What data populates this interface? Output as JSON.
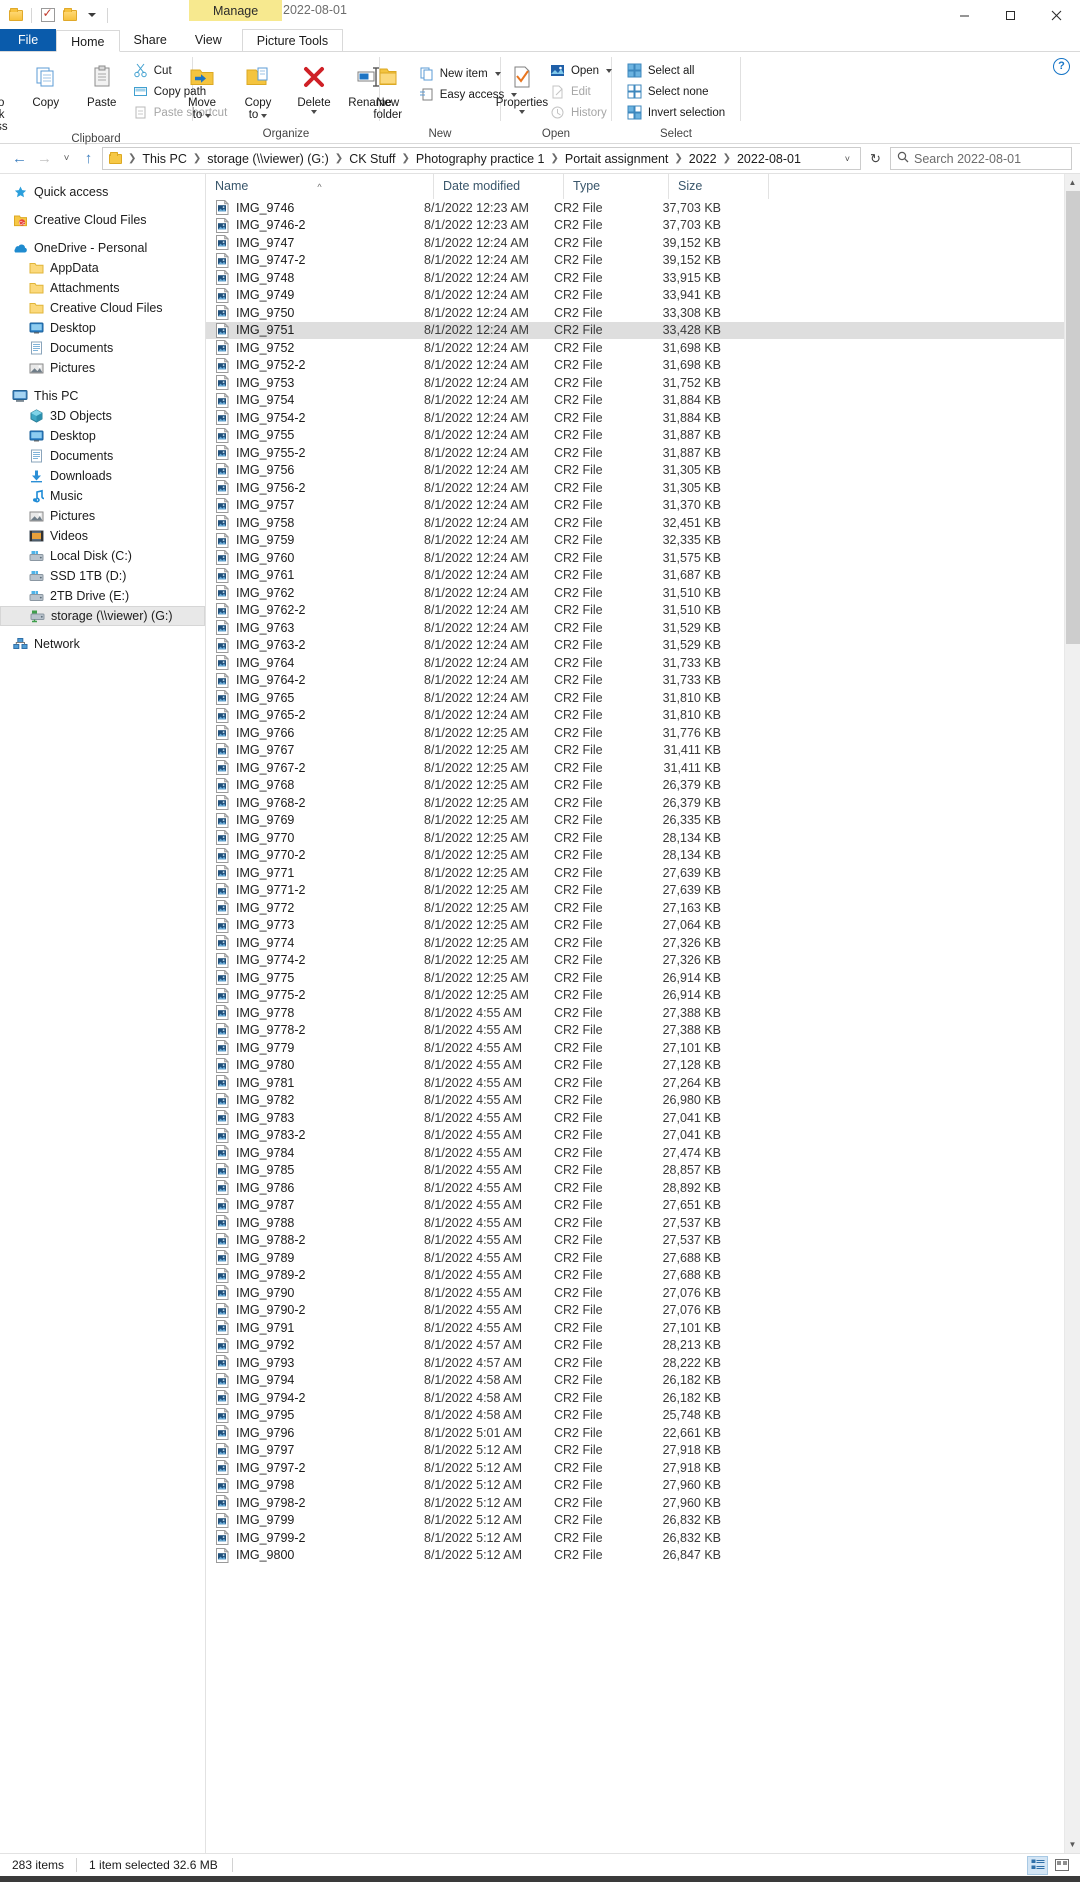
{
  "window": {
    "contextual_tab": "Manage",
    "title": "2022-08-01",
    "minimize": "minimize",
    "maximize": "maximize",
    "close": "close",
    "help": "?"
  },
  "quick_access_toolbar": {
    "items": [
      "folder-icon",
      "properties-icon",
      "new-folder-icon",
      "customize-caret"
    ]
  },
  "ribbon_tabs": [
    {
      "label": "File",
      "id": "file"
    },
    {
      "label": "Home",
      "id": "home"
    },
    {
      "label": "Share",
      "id": "share"
    },
    {
      "label": "View",
      "id": "view"
    },
    {
      "label": "Picture Tools",
      "id": "picture-tools"
    }
  ],
  "ribbon": {
    "groups": [
      {
        "label": "Clipboard",
        "big": [
          {
            "label": "Pin to Quick\naccess",
            "line1": "Pin to Quick",
            "line2": "access",
            "icon": "pin-icon"
          },
          {
            "label": "Copy",
            "line1": "Copy",
            "line2": "",
            "icon": "copy-icon"
          },
          {
            "label": "Paste",
            "line1": "Paste",
            "line2": "",
            "icon": "paste-icon"
          }
        ],
        "small": [
          {
            "label": "Cut",
            "icon": "scissors-icon",
            "disabled": false
          },
          {
            "label": "Copy path",
            "icon": "copy-path-icon",
            "disabled": false
          },
          {
            "label": "Paste shortcut",
            "icon": "paste-shortcut-icon",
            "disabled": true
          }
        ]
      },
      {
        "label": "Organize",
        "big": [
          {
            "line1": "Move",
            "line2": "to",
            "icon": "move-to-icon",
            "caret": true
          },
          {
            "line1": "Copy",
            "line2": "to",
            "icon": "copy-to-icon",
            "caret": true
          },
          {
            "line1": "Delete",
            "line2": "",
            "icon": "delete-icon",
            "caret": true
          },
          {
            "line1": "Rename",
            "line2": "",
            "icon": "rename-icon",
            "caret": false
          }
        ],
        "small": []
      },
      {
        "label": "New",
        "big": [
          {
            "line1": "New",
            "line2": "folder",
            "icon": "new-folder-icon",
            "caret": false
          }
        ],
        "small": [
          {
            "label": "New item",
            "icon": "new-item-icon",
            "disabled": false,
            "caret": true
          },
          {
            "label": "Easy access",
            "icon": "easy-access-icon",
            "disabled": false,
            "caret": true
          }
        ]
      },
      {
        "label": "Open",
        "big": [
          {
            "line1": "Properties",
            "line2": "",
            "icon": "properties-icon",
            "caret": true
          }
        ],
        "small": [
          {
            "label": "Open",
            "icon": "open-icon",
            "disabled": false,
            "caret": true
          },
          {
            "label": "Edit",
            "icon": "edit-icon",
            "disabled": true,
            "caret": false
          },
          {
            "label": "History",
            "icon": "history-icon",
            "disabled": true,
            "caret": false
          }
        ]
      },
      {
        "label": "Select",
        "big": [],
        "small": [
          {
            "label": "Select all",
            "icon": "select-all-icon",
            "disabled": false
          },
          {
            "label": "Select none",
            "icon": "select-none-icon",
            "disabled": false
          },
          {
            "label": "Invert selection",
            "icon": "invert-selection-icon",
            "disabled": false
          }
        ]
      }
    ]
  },
  "address_bar": {
    "back": "←",
    "forward": "→",
    "recent": "˅",
    "up": "↑",
    "breadcrumbs": [
      "This PC",
      "storage (\\\\viewer) (G:)",
      "CK Stuff",
      "Photography practice 1",
      "Portait assignment",
      "2022",
      "2022-08-01"
    ],
    "dropdown_caret": "˅",
    "refresh": "↻",
    "search_placeholder": "Search 2022-08-01",
    "search_value": ""
  },
  "sidebar": {
    "items": [
      {
        "label": "Quick access",
        "icon": "star-pin-icon",
        "level": 0,
        "selected": false
      },
      {
        "label": "Creative Cloud Files",
        "icon": "creative-cloud-icon",
        "level": 0,
        "selected": false
      },
      {
        "label": "OneDrive - Personal",
        "icon": "onedrive-icon",
        "level": 0,
        "selected": false
      },
      {
        "label": "AppData",
        "icon": "folder-icon",
        "level": 1,
        "selected": false
      },
      {
        "label": "Attachments",
        "icon": "folder-icon",
        "level": 1,
        "selected": false
      },
      {
        "label": "Creative Cloud Files",
        "icon": "folder-icon",
        "level": 1,
        "selected": false
      },
      {
        "label": "Desktop",
        "icon": "desktop-icon",
        "level": 1,
        "selected": false
      },
      {
        "label": "Documents",
        "icon": "documents-icon",
        "level": 1,
        "selected": false
      },
      {
        "label": "Pictures",
        "icon": "pictures-icon",
        "level": 1,
        "selected": false
      },
      {
        "label": "This PC",
        "icon": "this-pc-icon",
        "level": 0,
        "selected": false
      },
      {
        "label": "3D Objects",
        "icon": "3d-objects-icon",
        "level": 1,
        "selected": false
      },
      {
        "label": "Desktop",
        "icon": "desktop-icon",
        "level": 1,
        "selected": false
      },
      {
        "label": "Documents",
        "icon": "documents-icon",
        "level": 1,
        "selected": false
      },
      {
        "label": "Downloads",
        "icon": "downloads-icon",
        "level": 1,
        "selected": false
      },
      {
        "label": "Music",
        "icon": "music-icon",
        "level": 1,
        "selected": false
      },
      {
        "label": "Pictures",
        "icon": "pictures-icon",
        "level": 1,
        "selected": false
      },
      {
        "label": "Videos",
        "icon": "videos-icon",
        "level": 1,
        "selected": false
      },
      {
        "label": "Local Disk (C:)",
        "icon": "drive-icon",
        "level": 1,
        "selected": false
      },
      {
        "label": "SSD 1TB (D:)",
        "icon": "drive-icon",
        "level": 1,
        "selected": false
      },
      {
        "label": "2TB Drive (E:)",
        "icon": "drive-icon",
        "level": 1,
        "selected": false
      },
      {
        "label": "storage (\\\\viewer) (G:)",
        "icon": "network-drive-icon",
        "level": 1,
        "selected": true
      },
      {
        "label": "Network",
        "icon": "network-icon",
        "level": 0,
        "selected": false
      }
    ]
  },
  "file_list": {
    "columns": [
      {
        "label": "Name",
        "sorted": "asc"
      },
      {
        "label": "Date modified",
        "sorted": ""
      },
      {
        "label": "Type",
        "sorted": ""
      },
      {
        "label": "Size",
        "sorted": ""
      }
    ],
    "selected_index": 7,
    "rows": [
      {
        "name": "IMG_9746",
        "date": "8/1/2022 12:23 AM",
        "type": "CR2 File",
        "size": "37,703 KB"
      },
      {
        "name": "IMG_9746-2",
        "date": "8/1/2022 12:23 AM",
        "type": "CR2 File",
        "size": "37,703 KB"
      },
      {
        "name": "IMG_9747",
        "date": "8/1/2022 12:24 AM",
        "type": "CR2 File",
        "size": "39,152 KB"
      },
      {
        "name": "IMG_9747-2",
        "date": "8/1/2022 12:24 AM",
        "type": "CR2 File",
        "size": "39,152 KB"
      },
      {
        "name": "IMG_9748",
        "date": "8/1/2022 12:24 AM",
        "type": "CR2 File",
        "size": "33,915 KB"
      },
      {
        "name": "IMG_9749",
        "date": "8/1/2022 12:24 AM",
        "type": "CR2 File",
        "size": "33,941 KB"
      },
      {
        "name": "IMG_9750",
        "date": "8/1/2022 12:24 AM",
        "type": "CR2 File",
        "size": "33,308 KB"
      },
      {
        "name": "IMG_9751",
        "date": "8/1/2022 12:24 AM",
        "type": "CR2 File",
        "size": "33,428 KB"
      },
      {
        "name": "IMG_9752",
        "date": "8/1/2022 12:24 AM",
        "type": "CR2 File",
        "size": "31,698 KB"
      },
      {
        "name": "IMG_9752-2",
        "date": "8/1/2022 12:24 AM",
        "type": "CR2 File",
        "size": "31,698 KB"
      },
      {
        "name": "IMG_9753",
        "date": "8/1/2022 12:24 AM",
        "type": "CR2 File",
        "size": "31,752 KB"
      },
      {
        "name": "IMG_9754",
        "date": "8/1/2022 12:24 AM",
        "type": "CR2 File",
        "size": "31,884 KB"
      },
      {
        "name": "IMG_9754-2",
        "date": "8/1/2022 12:24 AM",
        "type": "CR2 File",
        "size": "31,884 KB"
      },
      {
        "name": "IMG_9755",
        "date": "8/1/2022 12:24 AM",
        "type": "CR2 File",
        "size": "31,887 KB"
      },
      {
        "name": "IMG_9755-2",
        "date": "8/1/2022 12:24 AM",
        "type": "CR2 File",
        "size": "31,887 KB"
      },
      {
        "name": "IMG_9756",
        "date": "8/1/2022 12:24 AM",
        "type": "CR2 File",
        "size": "31,305 KB"
      },
      {
        "name": "IMG_9756-2",
        "date": "8/1/2022 12:24 AM",
        "type": "CR2 File",
        "size": "31,305 KB"
      },
      {
        "name": "IMG_9757",
        "date": "8/1/2022 12:24 AM",
        "type": "CR2 File",
        "size": "31,370 KB"
      },
      {
        "name": "IMG_9758",
        "date": "8/1/2022 12:24 AM",
        "type": "CR2 File",
        "size": "32,451 KB"
      },
      {
        "name": "IMG_9759",
        "date": "8/1/2022 12:24 AM",
        "type": "CR2 File",
        "size": "32,335 KB"
      },
      {
        "name": "IMG_9760",
        "date": "8/1/2022 12:24 AM",
        "type": "CR2 File",
        "size": "31,575 KB"
      },
      {
        "name": "IMG_9761",
        "date": "8/1/2022 12:24 AM",
        "type": "CR2 File",
        "size": "31,687 KB"
      },
      {
        "name": "IMG_9762",
        "date": "8/1/2022 12:24 AM",
        "type": "CR2 File",
        "size": "31,510 KB"
      },
      {
        "name": "IMG_9762-2",
        "date": "8/1/2022 12:24 AM",
        "type": "CR2 File",
        "size": "31,510 KB"
      },
      {
        "name": "IMG_9763",
        "date": "8/1/2022 12:24 AM",
        "type": "CR2 File",
        "size": "31,529 KB"
      },
      {
        "name": "IMG_9763-2",
        "date": "8/1/2022 12:24 AM",
        "type": "CR2 File",
        "size": "31,529 KB"
      },
      {
        "name": "IMG_9764",
        "date": "8/1/2022 12:24 AM",
        "type": "CR2 File",
        "size": "31,733 KB"
      },
      {
        "name": "IMG_9764-2",
        "date": "8/1/2022 12:24 AM",
        "type": "CR2 File",
        "size": "31,733 KB"
      },
      {
        "name": "IMG_9765",
        "date": "8/1/2022 12:24 AM",
        "type": "CR2 File",
        "size": "31,810 KB"
      },
      {
        "name": "IMG_9765-2",
        "date": "8/1/2022 12:24 AM",
        "type": "CR2 File",
        "size": "31,810 KB"
      },
      {
        "name": "IMG_9766",
        "date": "8/1/2022 12:25 AM",
        "type": "CR2 File",
        "size": "31,776 KB"
      },
      {
        "name": "IMG_9767",
        "date": "8/1/2022 12:25 AM",
        "type": "CR2 File",
        "size": "31,411 KB"
      },
      {
        "name": "IMG_9767-2",
        "date": "8/1/2022 12:25 AM",
        "type": "CR2 File",
        "size": "31,411 KB"
      },
      {
        "name": "IMG_9768",
        "date": "8/1/2022 12:25 AM",
        "type": "CR2 File",
        "size": "26,379 KB"
      },
      {
        "name": "IMG_9768-2",
        "date": "8/1/2022 12:25 AM",
        "type": "CR2 File",
        "size": "26,379 KB"
      },
      {
        "name": "IMG_9769",
        "date": "8/1/2022 12:25 AM",
        "type": "CR2 File",
        "size": "26,335 KB"
      },
      {
        "name": "IMG_9770",
        "date": "8/1/2022 12:25 AM",
        "type": "CR2 File",
        "size": "28,134 KB"
      },
      {
        "name": "IMG_9770-2",
        "date": "8/1/2022 12:25 AM",
        "type": "CR2 File",
        "size": "28,134 KB"
      },
      {
        "name": "IMG_9771",
        "date": "8/1/2022 12:25 AM",
        "type": "CR2 File",
        "size": "27,639 KB"
      },
      {
        "name": "IMG_9771-2",
        "date": "8/1/2022 12:25 AM",
        "type": "CR2 File",
        "size": "27,639 KB"
      },
      {
        "name": "IMG_9772",
        "date": "8/1/2022 12:25 AM",
        "type": "CR2 File",
        "size": "27,163 KB"
      },
      {
        "name": "IMG_9773",
        "date": "8/1/2022 12:25 AM",
        "type": "CR2 File",
        "size": "27,064 KB"
      },
      {
        "name": "IMG_9774",
        "date": "8/1/2022 12:25 AM",
        "type": "CR2 File",
        "size": "27,326 KB"
      },
      {
        "name": "IMG_9774-2",
        "date": "8/1/2022 12:25 AM",
        "type": "CR2 File",
        "size": "27,326 KB"
      },
      {
        "name": "IMG_9775",
        "date": "8/1/2022 12:25 AM",
        "type": "CR2 File",
        "size": "26,914 KB"
      },
      {
        "name": "IMG_9775-2",
        "date": "8/1/2022 12:25 AM",
        "type": "CR2 File",
        "size": "26,914 KB"
      },
      {
        "name": "IMG_9778",
        "date": "8/1/2022 4:55 AM",
        "type": "CR2 File",
        "size": "27,388 KB"
      },
      {
        "name": "IMG_9778-2",
        "date": "8/1/2022 4:55 AM",
        "type": "CR2 File",
        "size": "27,388 KB"
      },
      {
        "name": "IMG_9779",
        "date": "8/1/2022 4:55 AM",
        "type": "CR2 File",
        "size": "27,101 KB"
      },
      {
        "name": "IMG_9780",
        "date": "8/1/2022 4:55 AM",
        "type": "CR2 File",
        "size": "27,128 KB"
      },
      {
        "name": "IMG_9781",
        "date": "8/1/2022 4:55 AM",
        "type": "CR2 File",
        "size": "27,264 KB"
      },
      {
        "name": "IMG_9782",
        "date": "8/1/2022 4:55 AM",
        "type": "CR2 File",
        "size": "26,980 KB"
      },
      {
        "name": "IMG_9783",
        "date": "8/1/2022 4:55 AM",
        "type": "CR2 File",
        "size": "27,041 KB"
      },
      {
        "name": "IMG_9783-2",
        "date": "8/1/2022 4:55 AM",
        "type": "CR2 File",
        "size": "27,041 KB"
      },
      {
        "name": "IMG_9784",
        "date": "8/1/2022 4:55 AM",
        "type": "CR2 File",
        "size": "27,474 KB"
      },
      {
        "name": "IMG_9785",
        "date": "8/1/2022 4:55 AM",
        "type": "CR2 File",
        "size": "28,857 KB"
      },
      {
        "name": "IMG_9786",
        "date": "8/1/2022 4:55 AM",
        "type": "CR2 File",
        "size": "28,892 KB"
      },
      {
        "name": "IMG_9787",
        "date": "8/1/2022 4:55 AM",
        "type": "CR2 File",
        "size": "27,651 KB"
      },
      {
        "name": "IMG_9788",
        "date": "8/1/2022 4:55 AM",
        "type": "CR2 File",
        "size": "27,537 KB"
      },
      {
        "name": "IMG_9788-2",
        "date": "8/1/2022 4:55 AM",
        "type": "CR2 File",
        "size": "27,537 KB"
      },
      {
        "name": "IMG_9789",
        "date": "8/1/2022 4:55 AM",
        "type": "CR2 File",
        "size": "27,688 KB"
      },
      {
        "name": "IMG_9789-2",
        "date": "8/1/2022 4:55 AM",
        "type": "CR2 File",
        "size": "27,688 KB"
      },
      {
        "name": "IMG_9790",
        "date": "8/1/2022 4:55 AM",
        "type": "CR2 File",
        "size": "27,076 KB"
      },
      {
        "name": "IMG_9790-2",
        "date": "8/1/2022 4:55 AM",
        "type": "CR2 File",
        "size": "27,076 KB"
      },
      {
        "name": "IMG_9791",
        "date": "8/1/2022 4:55 AM",
        "type": "CR2 File",
        "size": "27,101 KB"
      },
      {
        "name": "IMG_9792",
        "date": "8/1/2022 4:57 AM",
        "type": "CR2 File",
        "size": "28,213 KB"
      },
      {
        "name": "IMG_9793",
        "date": "8/1/2022 4:57 AM",
        "type": "CR2 File",
        "size": "28,222 KB"
      },
      {
        "name": "IMG_9794",
        "date": "8/1/2022 4:58 AM",
        "type": "CR2 File",
        "size": "26,182 KB"
      },
      {
        "name": "IMG_9794-2",
        "date": "8/1/2022 4:58 AM",
        "type": "CR2 File",
        "size": "26,182 KB"
      },
      {
        "name": "IMG_9795",
        "date": "8/1/2022 4:58 AM",
        "type": "CR2 File",
        "size": "25,748 KB"
      },
      {
        "name": "IMG_9796",
        "date": "8/1/2022 5:01 AM",
        "type": "CR2 File",
        "size": "22,661 KB"
      },
      {
        "name": "IMG_9797",
        "date": "8/1/2022 5:12 AM",
        "type": "CR2 File",
        "size": "27,918 KB"
      },
      {
        "name": "IMG_9797-2",
        "date": "8/1/2022 5:12 AM",
        "type": "CR2 File",
        "size": "27,918 KB"
      },
      {
        "name": "IMG_9798",
        "date": "8/1/2022 5:12 AM",
        "type": "CR2 File",
        "size": "27,960 KB"
      },
      {
        "name": "IMG_9798-2",
        "date": "8/1/2022 5:12 AM",
        "type": "CR2 File",
        "size": "27,960 KB"
      },
      {
        "name": "IMG_9799",
        "date": "8/1/2022 5:12 AM",
        "type": "CR2 File",
        "size": "26,832 KB"
      },
      {
        "name": "IMG_9799-2",
        "date": "8/1/2022 5:12 AM",
        "type": "CR2 File",
        "size": "26,832 KB"
      },
      {
        "name": "IMG_9800",
        "date": "8/1/2022 5:12 AM",
        "type": "CR2 File",
        "size": "26,847 KB"
      }
    ]
  },
  "status_bar": {
    "item_count": "283 items",
    "selection": "1 item selected  32.6 MB",
    "view_details_icon": "details-view-icon",
    "view_large_icon": "large-icons-view-icon"
  }
}
